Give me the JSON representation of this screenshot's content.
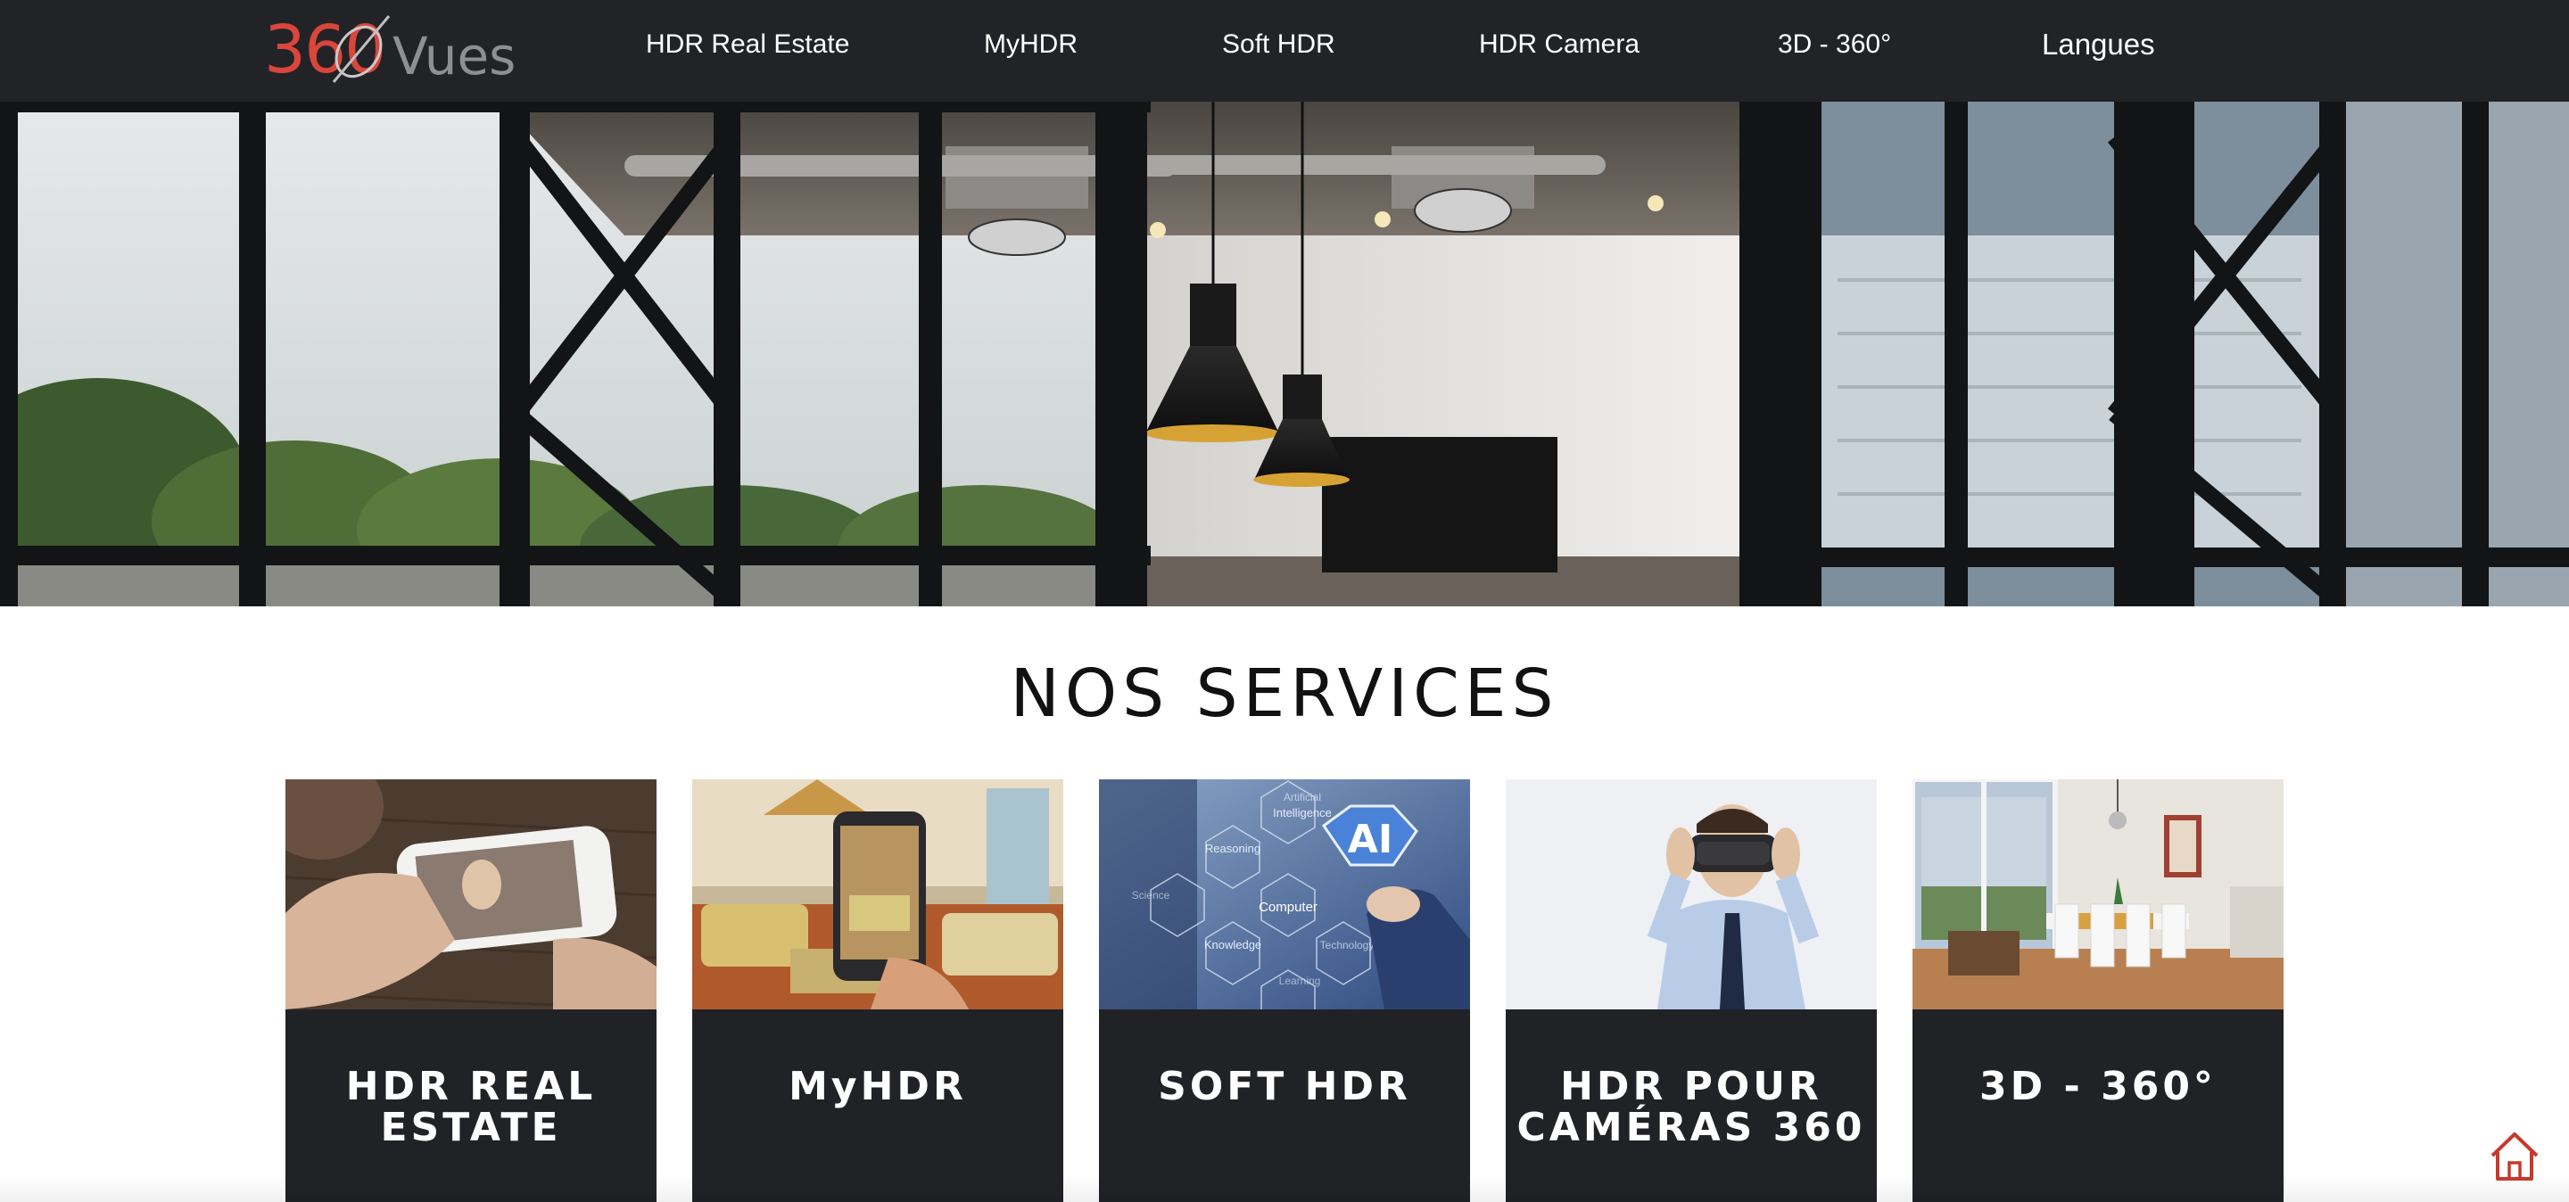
{
  "header": {
    "logo": {
      "number": "360",
      "word": "Vues"
    },
    "nav": [
      {
        "label": "HDR Real Estate"
      },
      {
        "label": "MyHDR"
      },
      {
        "label": "Soft HDR"
      },
      {
        "label": "HDR Camera"
      },
      {
        "label": "3D - 360°"
      },
      {
        "label": "Langues"
      }
    ]
  },
  "hero": {
    "image": "modern-loft-interior-photo"
  },
  "services": {
    "title": "NOS SERVICES",
    "cards": [
      {
        "label": "HDR REAL ESTATE",
        "image": "hands-holding-smartphone"
      },
      {
        "label": "MyHDR",
        "image": "phone-photographing-living-room"
      },
      {
        "label": "SOFT HDR",
        "image": "ai-hexagon-network",
        "image_text": {
          "ai": "AI",
          "computer": "Computer",
          "reasoning": "Reasoning",
          "knowledge": "Knowledge",
          "intelligence": "Intelligence",
          "artificial": "Artificial",
          "learning": "Learning",
          "technology": "Technology",
          "science": "Science"
        }
      },
      {
        "label": "HDR POUR CAMÉRAS 360",
        "image": "man-with-vr-headset"
      },
      {
        "label": "3D - 360°",
        "image": "dining-room-render"
      }
    ]
  },
  "footer": {
    "home_icon": "home-icon"
  },
  "colors": {
    "nav_bg": "#222326",
    "card_bg": "#212226",
    "accent": "#d8463c",
    "text_dark": "#111111"
  }
}
